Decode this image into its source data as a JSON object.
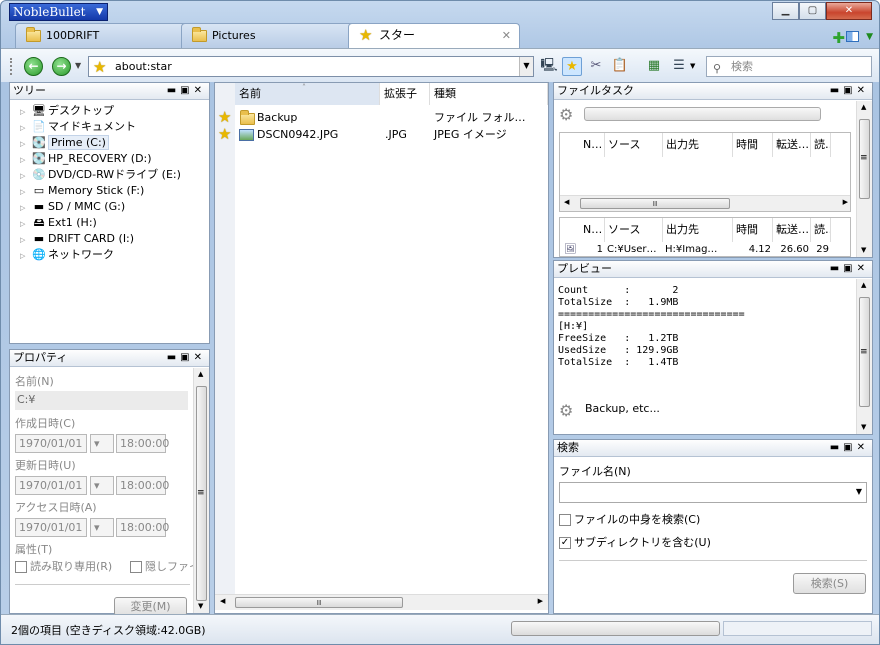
{
  "app": {
    "title": "NobleBullet"
  },
  "tabs": [
    {
      "label": "100DRIFT"
    },
    {
      "label": "Pictures"
    },
    {
      "label": "スター"
    }
  ],
  "toolbar": {
    "address": "about:star",
    "search_placeholder": "検索"
  },
  "tree": {
    "title": "ツリー",
    "items": [
      {
        "label": "デスクトップ",
        "icon": "desktop-icon"
      },
      {
        "label": "マイドキュメント",
        "icon": "documents-icon"
      },
      {
        "label": "Prime (C:)",
        "icon": "drive-icon"
      },
      {
        "label": "HP_RECOVERY (D:)",
        "icon": "drive-icon"
      },
      {
        "label": "DVD/CD-RWドライブ (E:)",
        "icon": "dvd-drive-icon"
      },
      {
        "label": "Memory Stick (F:)",
        "icon": "memory-stick-icon"
      },
      {
        "label": "SD / MMC (G:)",
        "icon": "sd-card-icon"
      },
      {
        "label": "Ext1 (H:)",
        "icon": "external-drive-icon"
      },
      {
        "label": "DRIFT CARD (I:)",
        "icon": "card-drive-icon"
      },
      {
        "label": "ネットワーク",
        "icon": "network-icon"
      }
    ]
  },
  "properties": {
    "title": "プロパティ",
    "name_label": "名前(N)",
    "name_value": "C:¥",
    "created_label": "作成日時(C)",
    "modified_label": "更新日時(U)",
    "accessed_label": "アクセス日時(A)",
    "date_value": "1970/01/01",
    "time_value": "18:00:00",
    "attr_label": "属性(T)",
    "readonly_label": "読み取り専用(R)",
    "hidden_label": "隠しファイ",
    "change_button": "変更(M)"
  },
  "files": {
    "columns": [
      "名前",
      "拡張子",
      "種類"
    ],
    "rows": [
      {
        "name": "Backup",
        "ext": "",
        "type": "ファイル フォル…"
      },
      {
        "name": "DSCN0942.JPG",
        "ext": ".JPG",
        "type": "JPEG イメージ"
      }
    ]
  },
  "filetask": {
    "title": "ファイルタスク",
    "columns": [
      "N…",
      "ソース",
      "出力先",
      "時間",
      "転送…",
      "読…"
    ],
    "rows": [
      {
        "n": "1",
        "source": "C:¥User…",
        "dest": "H:¥Imag…",
        "time": "4.12",
        "transfer": "26.60",
        "read": "29"
      }
    ]
  },
  "preview": {
    "title": "プレビュー",
    "lines": [
      "Count      :       2",
      "TotalSize  :   1.9MB",
      "===============================",
      "[H:¥]",
      "FreeSize   :   1.2TB",
      "UsedSize   : 129.9GB",
      "TotalSize  :   1.4TB"
    ],
    "footer": "Backup, etc..."
  },
  "searchpane": {
    "title": "検索",
    "filename_label": "ファイル名(N)",
    "content_label": "ファイルの中身を検索(C)",
    "subdir_label": "サブディレクトリを含む(U)",
    "button": "検索(S)"
  },
  "status": {
    "text": "2個の項目 (空きディスク領域:42.0GB)"
  }
}
